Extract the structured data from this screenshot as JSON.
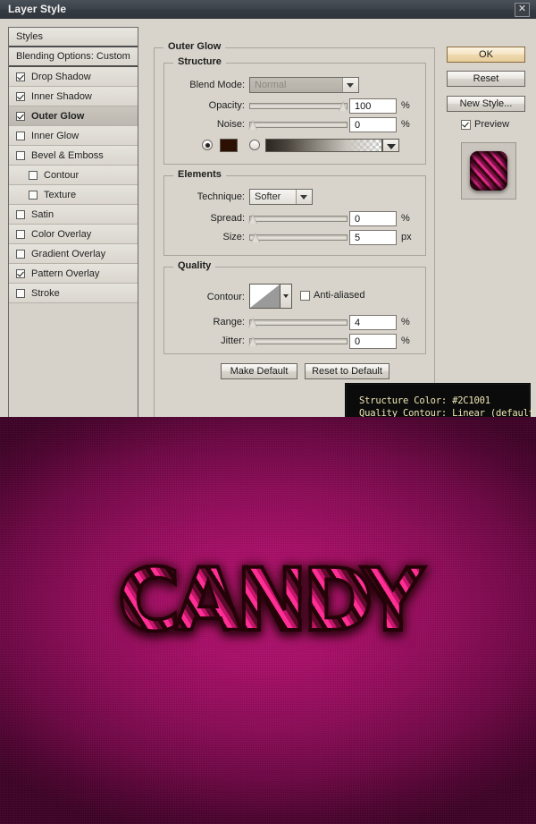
{
  "window": {
    "title": "Layer Style",
    "close_icon": "close-icon"
  },
  "styles_list": {
    "header": "Styles",
    "blending_options": "Blending Options: Custom",
    "items": [
      {
        "label": "Drop Shadow",
        "checked": true,
        "indent": false,
        "selected": false
      },
      {
        "label": "Inner Shadow",
        "checked": true,
        "indent": false,
        "selected": false
      },
      {
        "label": "Outer Glow",
        "checked": true,
        "indent": false,
        "selected": true
      },
      {
        "label": "Inner Glow",
        "checked": false,
        "indent": false,
        "selected": false
      },
      {
        "label": "Bevel & Emboss",
        "checked": false,
        "indent": false,
        "selected": false
      },
      {
        "label": "Contour",
        "checked": false,
        "indent": true,
        "selected": false
      },
      {
        "label": "Texture",
        "checked": false,
        "indent": true,
        "selected": false
      },
      {
        "label": "Satin",
        "checked": false,
        "indent": false,
        "selected": false
      },
      {
        "label": "Color Overlay",
        "checked": false,
        "indent": false,
        "selected": false
      },
      {
        "label": "Gradient Overlay",
        "checked": false,
        "indent": false,
        "selected": false
      },
      {
        "label": "Pattern Overlay",
        "checked": true,
        "indent": false,
        "selected": false
      },
      {
        "label": "Stroke",
        "checked": false,
        "indent": false,
        "selected": false
      }
    ]
  },
  "panel": {
    "title": "Outer Glow",
    "structure": {
      "title": "Structure",
      "blend_mode_label": "Blend Mode:",
      "blend_mode_value": "Normal",
      "opacity_label": "Opacity:",
      "opacity_value": "100",
      "opacity_unit": "%",
      "opacity_pct": 100,
      "noise_label": "Noise:",
      "noise_value": "0",
      "noise_unit": "%",
      "noise_pct": 0,
      "color_mode": "solid",
      "color_swatch": "#2C1001"
    },
    "elements": {
      "title": "Elements",
      "technique_label": "Technique:",
      "technique_value": "Softer",
      "spread_label": "Spread:",
      "spread_value": "0",
      "spread_unit": "%",
      "spread_pct": 0,
      "size_label": "Size:",
      "size_value": "5",
      "size_unit": "px",
      "size_pct": 3
    },
    "quality": {
      "title": "Quality",
      "contour_label": "Contour:",
      "contour_name": "Linear",
      "antialiased_label": "Anti-aliased",
      "antialiased_checked": false,
      "range_label": "Range:",
      "range_value": "4",
      "range_unit": "%",
      "range_pct": 4,
      "jitter_label": "Jitter:",
      "jitter_value": "0",
      "jitter_unit": "%",
      "jitter_pct": 0
    },
    "make_default_label": "Make Default",
    "reset_to_default_label": "Reset to Default"
  },
  "buttons": {
    "ok": "OK",
    "reset": "Reset",
    "new_style": "New Style...",
    "preview_label": "Preview",
    "preview_checked": true
  },
  "tooltip": {
    "line1": "Structure Color: #2C1001",
    "line2": "Quality Contour: Linear (default)",
    "text_color": "#EFE7B4",
    "background": "#0B0B0B",
    "accent_color": "#F3EF7C"
  },
  "artwork": {
    "text": "CANDY",
    "background_color": "#A50E66",
    "stripe_bright": "#FF2F95",
    "stripe_dark": "#240308"
  }
}
